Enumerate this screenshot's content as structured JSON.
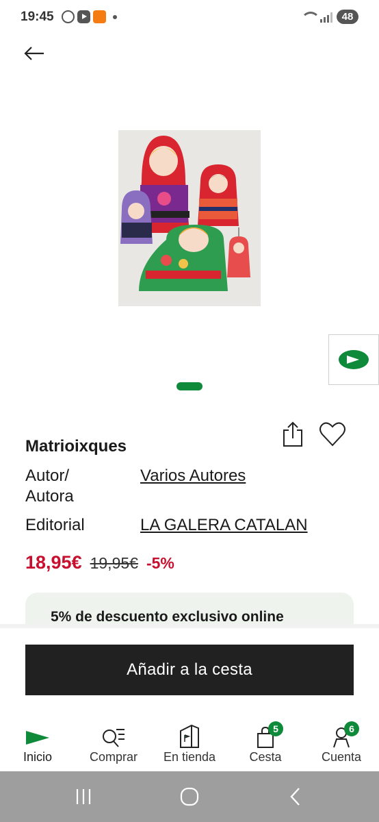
{
  "status_bar": {
    "time": "19:45",
    "battery": "48",
    "icons": [
      "whatsapp-icon",
      "youtube-icon",
      "temu-icon",
      "dot-icon",
      "wifi-icon",
      "signal-icon"
    ]
  },
  "product": {
    "title": "Matrioixques",
    "image_alt": "Matrioixques",
    "author_label_line1": "Autor/",
    "author_label_line2": "Autora",
    "author_value": "Varios Autores",
    "publisher_label": "Editorial",
    "publisher_value": "LA GALERA CATALAN"
  },
  "price": {
    "current": "18,95€",
    "old": "19,95€",
    "discount": "-5%"
  },
  "promo": {
    "text": "5% de descuento exclusivo online"
  },
  "actions": {
    "add_to_cart": "Añadir a la cesta"
  },
  "bottom_nav": {
    "items": [
      {
        "label": "Inicio",
        "icon": "flag-icon"
      },
      {
        "label": "Comprar",
        "icon": "search-list-icon"
      },
      {
        "label": "En tienda",
        "icon": "store-icon"
      },
      {
        "label": "Cesta",
        "icon": "bag-icon",
        "badge": "5"
      },
      {
        "label": "Cuenta",
        "icon": "account-icon",
        "badge": "6"
      }
    ]
  },
  "colors": {
    "brand_green": "#0e8a3a",
    "price_red": "#c8102e",
    "button_dark": "#212121"
  }
}
